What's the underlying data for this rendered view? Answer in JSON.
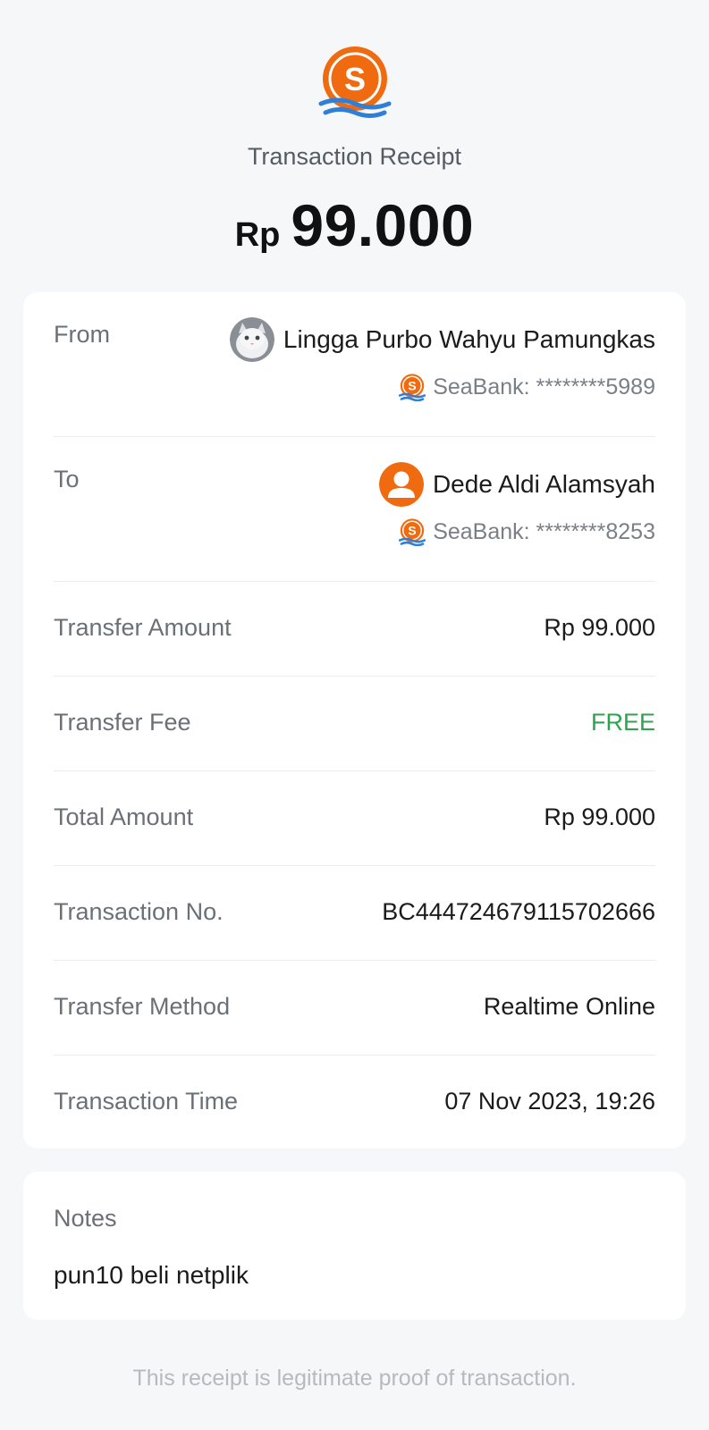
{
  "header": {
    "logo_icon": "seabank-logo-icon",
    "title": "Transaction Receipt",
    "amount_currency": "Rp",
    "amount_value": "99.000"
  },
  "from": {
    "label": "From",
    "name": "Lingga Purbo Wahyu Pamungkas",
    "avatar_icon": "cat-photo-avatar",
    "bank": "SeaBank: ********5989"
  },
  "to": {
    "label": "To",
    "name": "Dede Aldi Alamsyah",
    "avatar_icon": "default-user-avatar",
    "bank": "SeaBank: ********8253"
  },
  "details": [
    {
      "label": "Transfer Amount",
      "value": "Rp 99.000"
    },
    {
      "label": "Transfer Fee",
      "value": "FREE"
    },
    {
      "label": "Total Amount",
      "value": "Rp 99.000"
    },
    {
      "label": "Transaction No.",
      "value": "BC444724679115702666"
    },
    {
      "label": "Transfer Method",
      "value": "Realtime Online"
    },
    {
      "label": "Transaction Time",
      "value": "07 Nov 2023, 19:26"
    }
  ],
  "notes": {
    "label": "Notes",
    "text": "pun10 beli netplik"
  },
  "footer": {
    "text": "This receipt is legitimate proof of transaction."
  },
  "colors": {
    "brand_orange": "#f06a0f",
    "brand_blue": "#2f7ed8",
    "free_green": "#2ca44e",
    "background": "#f6f7f9"
  }
}
